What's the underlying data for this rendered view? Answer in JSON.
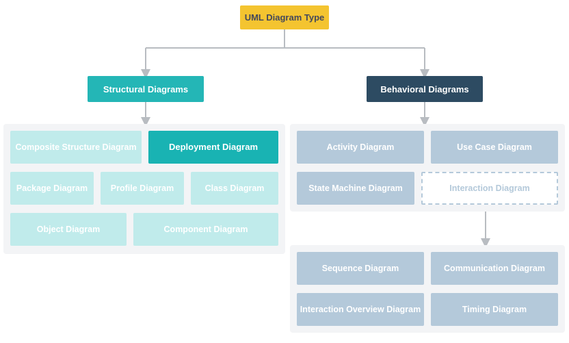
{
  "root": {
    "label": "UML Diagram Type"
  },
  "structural": {
    "header": "Structural Diagrams",
    "items": {
      "composite": "Composite Structure Diagram",
      "deployment": "Deployment Diagram",
      "package": "Package Diagram",
      "profile": "Profile Diagram",
      "class": "Class Diagram",
      "object": "Object Diagram",
      "component": "Component Diagram"
    }
  },
  "behavioral": {
    "header": "Behavioral Diagrams",
    "items": {
      "activity": "Activity Diagram",
      "usecase": "Use Case Diagram",
      "statemachine": "State Machine Diagram",
      "interaction": "Interaction Diagram"
    },
    "interaction_children": {
      "sequence": "Sequence Diagram",
      "communication": "Communication Diagram",
      "overview": "Interaction Overview Diagram",
      "timing": "Timing Diagram"
    }
  },
  "colors": {
    "root_bg": "#f4c430",
    "structural_header": "#24b6b6",
    "behavioral_header": "#2d4b62",
    "structural_node": "#c0ebeb",
    "structural_highlight": "#19b3b3",
    "behavioral_node": "#b4c9da",
    "panel": "#f3f4f6",
    "connector": "#b8bcc1"
  }
}
